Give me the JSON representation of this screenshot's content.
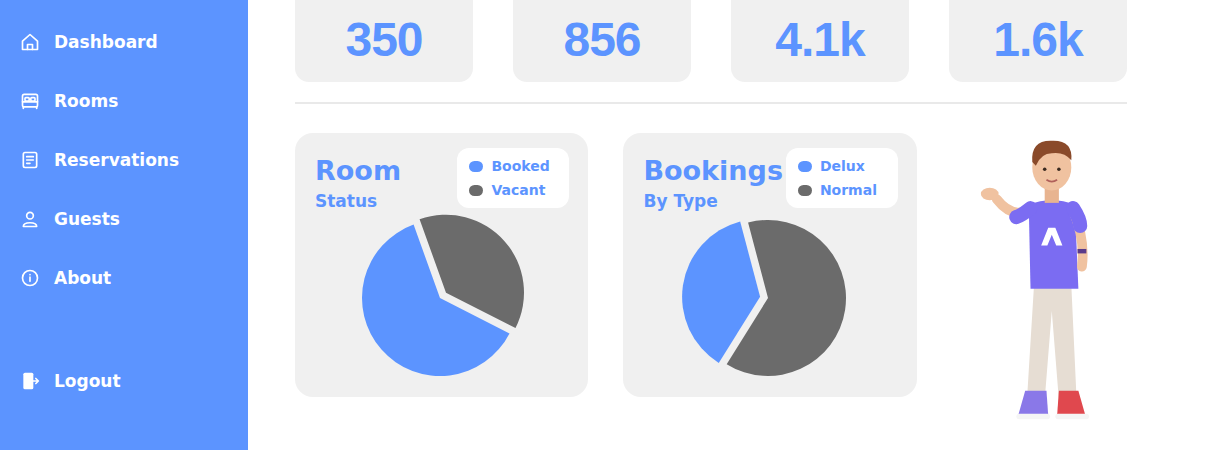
{
  "sidebar": {
    "items": [
      {
        "label": "Dashboard"
      },
      {
        "label": "Rooms"
      },
      {
        "label": "Reservations"
      },
      {
        "label": "Guests"
      },
      {
        "label": "About"
      }
    ],
    "logout": "Logout"
  },
  "stats": [
    "350",
    "856",
    "4.1k",
    "1.6k"
  ],
  "charts": [
    {
      "title": "Room",
      "subtitle": "Status",
      "values": [
        62,
        38
      ],
      "legend": [
        {
          "label": "Booked",
          "color": "#5c94ff",
          "exploded": false
        },
        {
          "label": "Vacant",
          "color": "#6b6b6b",
          "exploded": true
        }
      ]
    },
    {
      "title": "Bookings",
      "subtitle": "By Type",
      "values": [
        37,
        63
      ],
      "legend": [
        {
          "label": "Delux",
          "color": "#5c94ff",
          "exploded": true
        },
        {
          "label": "Normal",
          "color": "#6b6b6b",
          "exploded": false
        }
      ]
    }
  ]
}
